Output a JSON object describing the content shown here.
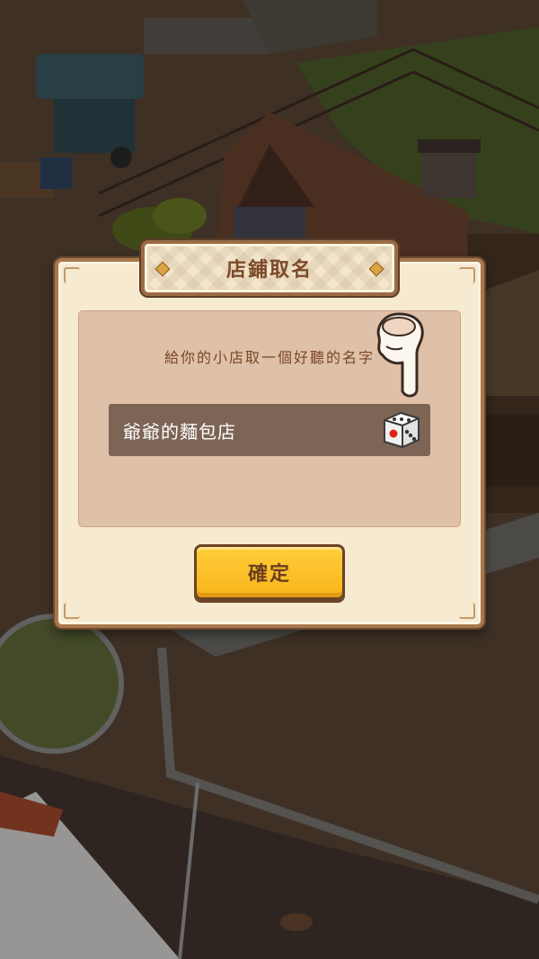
{
  "dialog": {
    "title": "店鋪取名",
    "prompt": "給你的小店取一個好聽的名字",
    "name_value": "爺爺的麵包店",
    "confirm_label": "確定"
  },
  "icons": {
    "random_name": "dice-icon",
    "hint": "pointing-hand-icon"
  },
  "colors": {
    "confirm_button": "#f8b41b",
    "dialog_bg": "#f6ead0",
    "title_text": "#7b4a2a",
    "name_field_bg": "#7d6556"
  }
}
